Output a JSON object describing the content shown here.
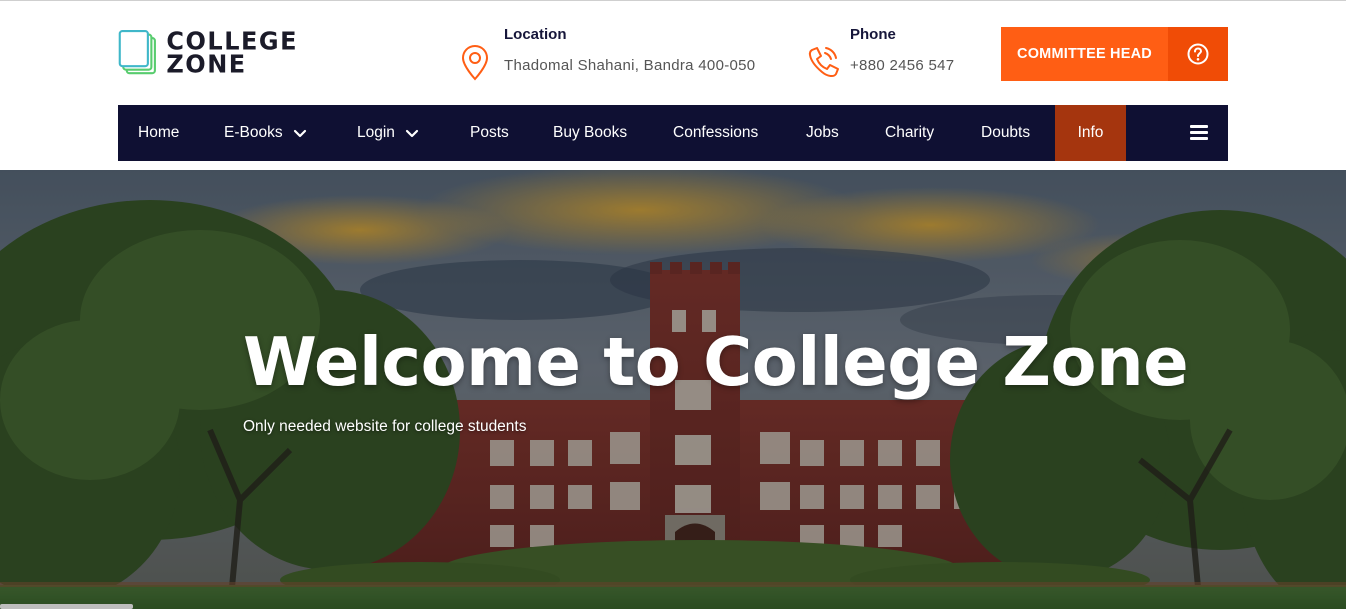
{
  "brand": {
    "line1": "COLLEGE",
    "line2": "ZONE",
    "colors": {
      "teal": "#3fb7c9",
      "green": "#58cc6e",
      "dark": "#1b1b29"
    }
  },
  "header": {
    "location": {
      "label": "Location",
      "value": "Thadomal Shahani, Bandra 400-050",
      "icon": "map-pin-icon"
    },
    "phone": {
      "label": "Phone",
      "value": "+880 2456 547",
      "icon": "phone-icon"
    },
    "cta": {
      "label": "COMMITTEE HEAD",
      "icon": "help-circle-icon"
    }
  },
  "nav": {
    "items": [
      {
        "label": "Home"
      },
      {
        "label": "E-Books",
        "dropdown": true
      },
      {
        "label": "Login",
        "dropdown": true
      },
      {
        "label": "Posts"
      },
      {
        "label": "Buy Books"
      },
      {
        "label": "Confessions"
      },
      {
        "label": "Jobs"
      },
      {
        "label": "Charity"
      },
      {
        "label": "Doubts"
      },
      {
        "label": "Info",
        "active": true
      }
    ],
    "menu_icon": "hamburger-menu-icon"
  },
  "hero": {
    "title": "Welcome to College Zone",
    "subtitle": "Only needed website for college students"
  },
  "colors": {
    "accent": "#ff5e14",
    "accent_dark": "#f04c06",
    "nav_bg": "#0f1033",
    "nav_active": "#a5350e"
  }
}
